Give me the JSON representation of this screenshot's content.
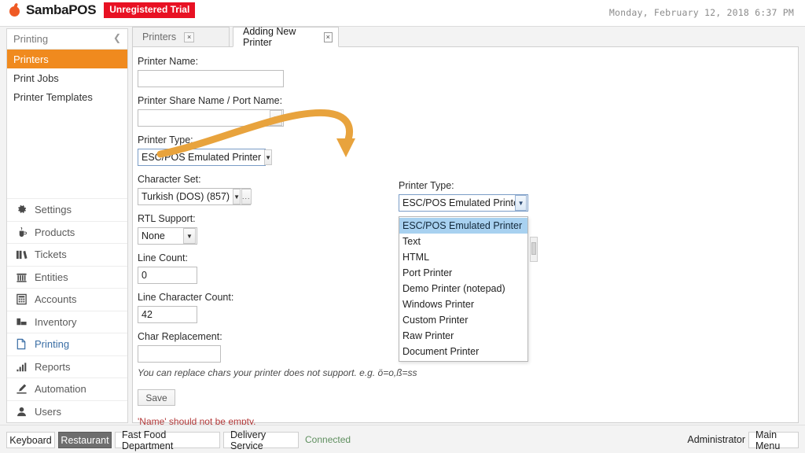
{
  "app": {
    "brand": "SambaPOS",
    "trial_badge": "Unregistered Trial",
    "datetime": "Monday, February 12, 2018 6:37 PM",
    "accent_orange": "#f08a1e",
    "badge_red": "#e81123",
    "link_blue": "#3a6ea5"
  },
  "sidebar": {
    "header": {
      "title": "Printing",
      "collapse_icon": "chevron-left-icon"
    },
    "group_items": [
      {
        "label": "Printers",
        "active": true
      },
      {
        "label": "Print Jobs",
        "active": false
      },
      {
        "label": "Printer Templates",
        "active": false
      }
    ],
    "nav_items": [
      {
        "label": "Settings",
        "icon": "gear-icon",
        "selected": false
      },
      {
        "label": "Products",
        "icon": "cup-icon",
        "selected": false
      },
      {
        "label": "Tickets",
        "icon": "books-icon",
        "selected": false
      },
      {
        "label": "Entities",
        "icon": "bank-icon",
        "selected": false
      },
      {
        "label": "Accounts",
        "icon": "calculator-icon",
        "selected": false
      },
      {
        "label": "Inventory",
        "icon": "boxes-icon",
        "selected": false
      },
      {
        "label": "Printing",
        "icon": "document-icon",
        "selected": true
      },
      {
        "label": "Reports",
        "icon": "bar-chart-icon",
        "selected": false
      },
      {
        "label": "Automation",
        "icon": "pen-icon",
        "selected": false
      },
      {
        "label": "Users",
        "icon": "user-icon",
        "selected": false
      }
    ]
  },
  "tabs": [
    {
      "label": "Printers",
      "active": false,
      "close": "×"
    },
    {
      "label": "Adding New Printer",
      "active": true,
      "close": "×"
    }
  ],
  "form": {
    "printer_name_label": "Printer Name:",
    "printer_name_value": "",
    "printer_name_placeholder": "",
    "share_name_label": "Printer Share Name / Port Name:",
    "share_name_value": "",
    "printer_type_label": "Printer Type:",
    "printer_type_value": "ESC/POS Emulated Printer",
    "character_set_label": "Character Set:",
    "character_set_value": "Turkish (DOS) (857)",
    "character_set_browse": "...",
    "rtl_support_label": "RTL Support:",
    "rtl_support_value": "None",
    "line_count_label": "Line Count:",
    "line_count_value": "0",
    "line_char_count_label": "Line Character Count:",
    "line_char_count_value": "42",
    "char_replacement_label": "Char Replacement:",
    "char_replacement_value": "",
    "hint": "You can replace chars your printer does not support. e.g. ö=o,ß=ss",
    "save_label": "Save",
    "error": "'Name' should not be empty."
  },
  "printer_type_panel": {
    "label": "Printer Type:",
    "selected": "ESC/POS Emulated Printer",
    "options": [
      "ESC/POS Emulated Printer",
      "Text",
      "HTML",
      "Port Printer",
      "Demo Printer (notepad)",
      "Windows Printer",
      "Custom Printer",
      "Raw Printer",
      "Document Printer"
    ],
    "selected_index": 0
  },
  "annotation": {
    "type": "curved-arrow",
    "color": "#e8a33d",
    "points_to": "printer-type-dropdown"
  },
  "statusbar": {
    "buttons": [
      {
        "label": "Keyboard",
        "pressed": false
      },
      {
        "label": "Restaurant",
        "pressed": true
      },
      {
        "label": "Fast Food Department",
        "pressed": false
      },
      {
        "label": "Delivery Service",
        "pressed": false
      }
    ],
    "connection": "Connected",
    "user": "Administrator",
    "main_menu": "Main Menu"
  }
}
